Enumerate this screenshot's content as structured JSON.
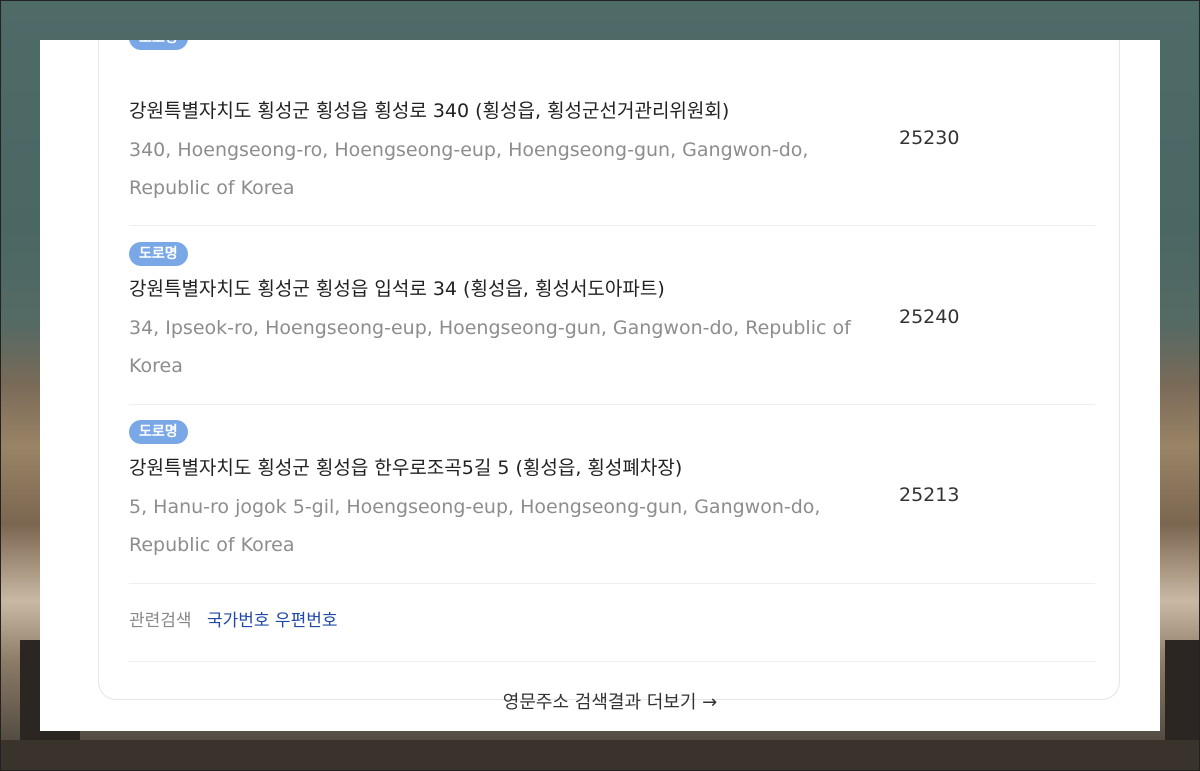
{
  "results": [
    {
      "badge": "도로명",
      "korean": "강원특별자치도 횡성군 횡성읍 횡성로 340 (횡성읍, 횡성군선거관리위원회)",
      "english": "340, Hoengseong-ro, Hoengseong-eup, Hoengseong-gun, Gangwon-do, Republic of Korea",
      "zip": "25230"
    },
    {
      "badge": "도로명",
      "korean": "강원특별자치도 횡성군 횡성읍 입석로 34 (횡성읍, 횡성서도아파트)",
      "english": "34, Ipseok-ro, Hoengseong-eup, Hoengseong-gun, Gangwon-do, Republic of Korea",
      "zip": "25240"
    },
    {
      "badge": "도로명",
      "korean": "강원특별자치도 횡성군 횡성읍 한우로조곡5길 5 (횡성읍, 횡성폐차장)",
      "english": "5, Hanu-ro jogok 5-gil, Hoengseong-eup, Hoengseong-gun, Gangwon-do, Republic of Korea",
      "zip": "25213"
    }
  ],
  "related": {
    "label": "관련검색",
    "link": "국가번호 우편번호"
  },
  "more_link": "영문주소 검색결과 더보기 →",
  "colors": {
    "badge": "#7aa8e6",
    "link": "#1f48a8",
    "english_text": "#8d8d8d"
  }
}
